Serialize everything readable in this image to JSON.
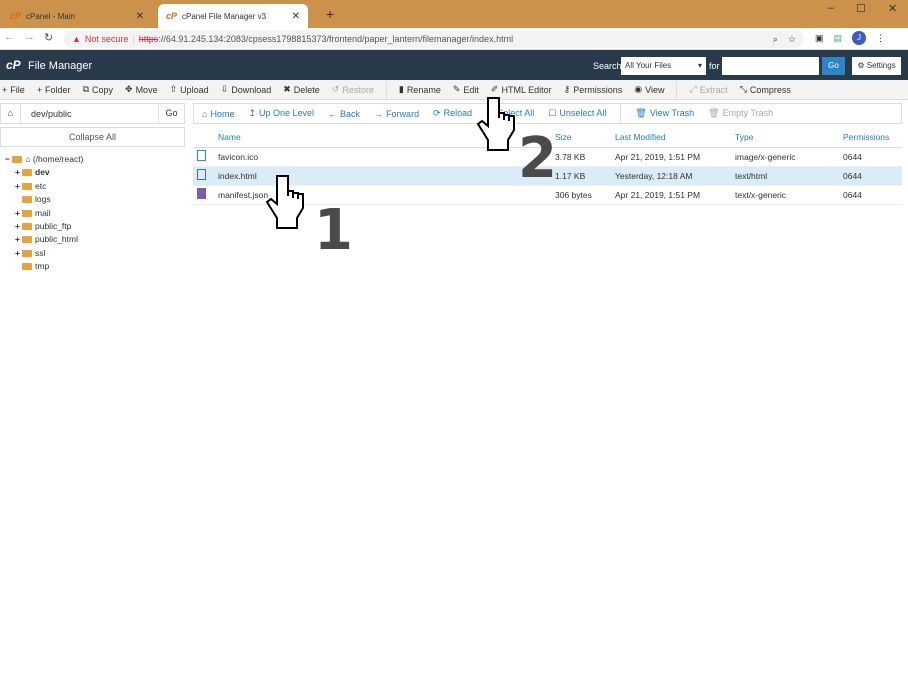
{
  "browser": {
    "tabs": [
      {
        "label": "cPanel - Main"
      },
      {
        "label": "cPanel File Manager v3"
      }
    ],
    "not_secure": "Not secure",
    "url_scheme": "https",
    "url_rest": "://64.91.245.134:2083/cpsess1798815373/frontend/paper_lantern/filemanager/index.html",
    "profile": "J"
  },
  "header": {
    "logo": "cP",
    "title": "File Manager",
    "search_label": "Search",
    "search_scope": "All Your Files",
    "for_label": "for",
    "go": "Go",
    "settings": "Settings"
  },
  "toolbar": [
    {
      "icon": "plus-icon",
      "label": "File"
    },
    {
      "icon": "plus-icon",
      "label": "Folder"
    },
    {
      "icon": "copy-icon",
      "label": "Copy"
    },
    {
      "icon": "move-icon",
      "label": "Move"
    },
    {
      "icon": "upload-icon",
      "label": "Upload"
    },
    {
      "icon": "download-icon",
      "label": "Download"
    },
    {
      "icon": "close-icon",
      "label": "Delete"
    },
    {
      "icon": "restore-icon",
      "label": "Restore",
      "disabled": true
    },
    {
      "icon": "file-icon",
      "label": "Rename"
    },
    {
      "icon": "pencil-icon",
      "label": "Edit"
    },
    {
      "icon": "edit-icon",
      "label": "HTML Editor"
    },
    {
      "icon": "key-icon",
      "label": "Permissions"
    },
    {
      "icon": "eye-icon",
      "label": "View"
    },
    {
      "icon": "extract-icon",
      "label": "Extract",
      "disabled": true
    },
    {
      "icon": "compress-icon",
      "label": "Compress"
    }
  ],
  "sidebar": {
    "path": "dev/public",
    "go": "Go",
    "collapse": "Collapse All",
    "root": "(/home/react)",
    "tree": [
      {
        "label": "dev",
        "expand": true,
        "bold": true
      },
      {
        "label": "etc",
        "expand": true
      },
      {
        "label": "logs",
        "expand": false
      },
      {
        "label": "mail",
        "expand": true
      },
      {
        "label": "public_ftp",
        "expand": true
      },
      {
        "label": "public_html",
        "expand": true
      },
      {
        "label": "ssl",
        "expand": true
      },
      {
        "label": "tmp",
        "expand": false
      }
    ]
  },
  "nav": [
    {
      "icon": "home-icon",
      "label": "Home"
    },
    {
      "icon": "up-icon",
      "label": "Up One Level"
    },
    {
      "icon": "arrow-left-icon",
      "label": "Back"
    },
    {
      "icon": "arrow-right-icon",
      "label": "Forward"
    },
    {
      "icon": "reload-icon",
      "label": "Reload"
    },
    {
      "icon": "checkbox-icon",
      "label": "Select All"
    },
    {
      "icon": "checkbox-icon",
      "label": "Unselect All"
    },
    {
      "icon": "trash-icon",
      "label": "View Trash"
    },
    {
      "icon": "trash-icon",
      "label": "Empty Trash",
      "disabled": true
    }
  ],
  "table": {
    "headers": [
      "Name",
      "Size",
      "Last Modified",
      "Type",
      "Permissions"
    ],
    "rows": [
      {
        "name": "favicon.ico",
        "size": "3.78 KB",
        "modified": "Apr 21, 2019, 1:51 PM",
        "type": "image/x-generic",
        "perms": "0644",
        "icon": "image-file-icon"
      },
      {
        "name": "index.html",
        "size": "1.17 KB",
        "modified": "Yesterday, 12:18 AM",
        "type": "text/html",
        "perms": "0644",
        "icon": "html-file-icon",
        "selected": true
      },
      {
        "name": "manifest.json",
        "size": "306 bytes",
        "modified": "Apr 21, 2019, 1:51 PM",
        "type": "text/x-generic",
        "perms": "0644",
        "icon": "text-file-icon"
      }
    ]
  },
  "annotations": {
    "step1": "1",
    "step2": "2"
  }
}
